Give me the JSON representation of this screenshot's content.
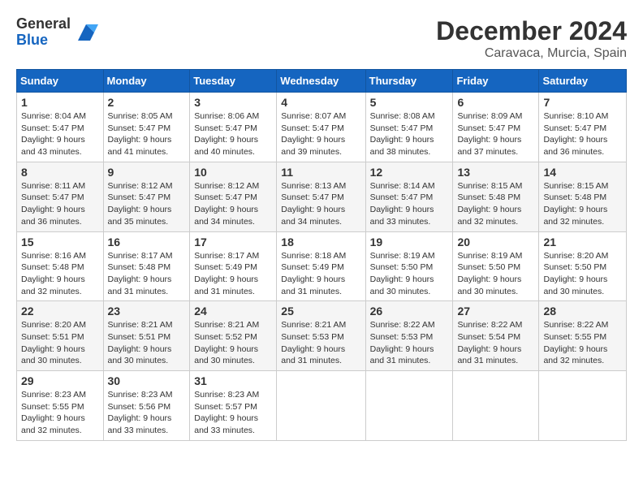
{
  "header": {
    "logo_general": "General",
    "logo_blue": "Blue",
    "month_title": "December 2024",
    "location": "Caravaca, Murcia, Spain"
  },
  "calendar": {
    "days_of_week": [
      "Sunday",
      "Monday",
      "Tuesday",
      "Wednesday",
      "Thursday",
      "Friday",
      "Saturday"
    ],
    "weeks": [
      [
        null,
        {
          "day": "2",
          "sunrise": "8:05 AM",
          "sunset": "5:47 PM",
          "daylight": "9 hours and 41 minutes."
        },
        {
          "day": "3",
          "sunrise": "8:06 AM",
          "sunset": "5:47 PM",
          "daylight": "9 hours and 40 minutes."
        },
        {
          "day": "4",
          "sunrise": "8:07 AM",
          "sunset": "5:47 PM",
          "daylight": "9 hours and 39 minutes."
        },
        {
          "day": "5",
          "sunrise": "8:08 AM",
          "sunset": "5:47 PM",
          "daylight": "9 hours and 38 minutes."
        },
        {
          "day": "6",
          "sunrise": "8:09 AM",
          "sunset": "5:47 PM",
          "daylight": "9 hours and 37 minutes."
        },
        {
          "day": "7",
          "sunrise": "8:10 AM",
          "sunset": "5:47 PM",
          "daylight": "9 hours and 36 minutes."
        }
      ],
      [
        {
          "day": "1",
          "sunrise": "8:04 AM",
          "sunset": "5:47 PM",
          "daylight": "9 hours and 43 minutes."
        },
        {
          "day": "9",
          "sunrise": "8:12 AM",
          "sunset": "5:47 PM",
          "daylight": "9 hours and 35 minutes."
        },
        {
          "day": "10",
          "sunrise": "8:12 AM",
          "sunset": "5:47 PM",
          "daylight": "9 hours and 34 minutes."
        },
        {
          "day": "11",
          "sunrise": "8:13 AM",
          "sunset": "5:47 PM",
          "daylight": "9 hours and 34 minutes."
        },
        {
          "day": "12",
          "sunrise": "8:14 AM",
          "sunset": "5:47 PM",
          "daylight": "9 hours and 33 minutes."
        },
        {
          "day": "13",
          "sunrise": "8:15 AM",
          "sunset": "5:48 PM",
          "daylight": "9 hours and 32 minutes."
        },
        {
          "day": "14",
          "sunrise": "8:15 AM",
          "sunset": "5:48 PM",
          "daylight": "9 hours and 32 minutes."
        }
      ],
      [
        {
          "day": "8",
          "sunrise": "8:11 AM",
          "sunset": "5:47 PM",
          "daylight": "9 hours and 36 minutes."
        },
        {
          "day": "16",
          "sunrise": "8:17 AM",
          "sunset": "5:48 PM",
          "daylight": "9 hours and 31 minutes."
        },
        {
          "day": "17",
          "sunrise": "8:17 AM",
          "sunset": "5:49 PM",
          "daylight": "9 hours and 31 minutes."
        },
        {
          "day": "18",
          "sunrise": "8:18 AM",
          "sunset": "5:49 PM",
          "daylight": "9 hours and 31 minutes."
        },
        {
          "day": "19",
          "sunrise": "8:19 AM",
          "sunset": "5:50 PM",
          "daylight": "9 hours and 30 minutes."
        },
        {
          "day": "20",
          "sunrise": "8:19 AM",
          "sunset": "5:50 PM",
          "daylight": "9 hours and 30 minutes."
        },
        {
          "day": "21",
          "sunrise": "8:20 AM",
          "sunset": "5:50 PM",
          "daylight": "9 hours and 30 minutes."
        }
      ],
      [
        {
          "day": "15",
          "sunrise": "8:16 AM",
          "sunset": "5:48 PM",
          "daylight": "9 hours and 32 minutes."
        },
        {
          "day": "23",
          "sunrise": "8:21 AM",
          "sunset": "5:51 PM",
          "daylight": "9 hours and 30 minutes."
        },
        {
          "day": "24",
          "sunrise": "8:21 AM",
          "sunset": "5:52 PM",
          "daylight": "9 hours and 30 minutes."
        },
        {
          "day": "25",
          "sunrise": "8:21 AM",
          "sunset": "5:53 PM",
          "daylight": "9 hours and 31 minutes."
        },
        {
          "day": "26",
          "sunrise": "8:22 AM",
          "sunset": "5:53 PM",
          "daylight": "9 hours and 31 minutes."
        },
        {
          "day": "27",
          "sunrise": "8:22 AM",
          "sunset": "5:54 PM",
          "daylight": "9 hours and 31 minutes."
        },
        {
          "day": "28",
          "sunrise": "8:22 AM",
          "sunset": "5:55 PM",
          "daylight": "9 hours and 32 minutes."
        }
      ],
      [
        {
          "day": "22",
          "sunrise": "8:20 AM",
          "sunset": "5:51 PM",
          "daylight": "9 hours and 30 minutes."
        },
        {
          "day": "30",
          "sunrise": "8:23 AM",
          "sunset": "5:56 PM",
          "daylight": "9 hours and 33 minutes."
        },
        {
          "day": "31",
          "sunrise": "8:23 AM",
          "sunset": "5:57 PM",
          "daylight": "9 hours and 33 minutes."
        },
        null,
        null,
        null,
        null
      ],
      [
        {
          "day": "29",
          "sunrise": "8:23 AM",
          "sunset": "5:55 PM",
          "daylight": "9 hours and 32 minutes."
        },
        null,
        null,
        null,
        null,
        null,
        null
      ]
    ]
  },
  "labels": {
    "sunrise": "Sunrise:",
    "sunset": "Sunset:",
    "daylight": "Daylight:"
  }
}
